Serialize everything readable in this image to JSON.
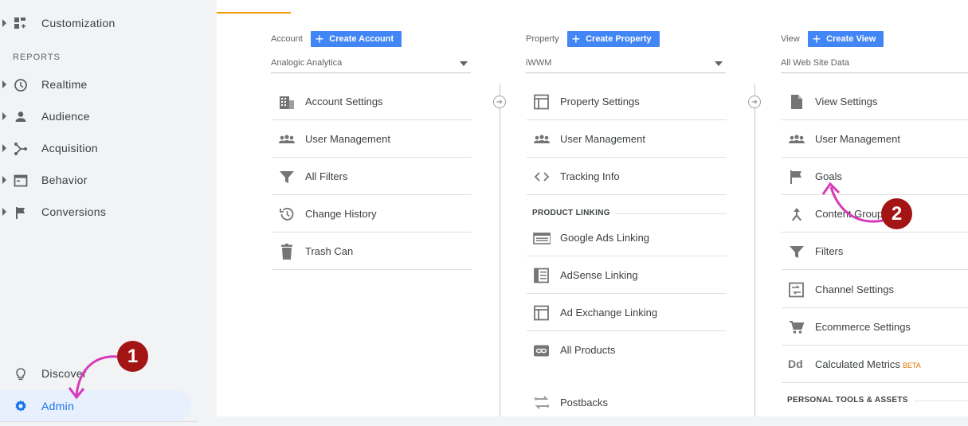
{
  "sidebar": {
    "customization": "Customization",
    "reports_heading": "REPORTS",
    "items": [
      {
        "label": "Realtime",
        "icon": "clock-icon"
      },
      {
        "label": "Audience",
        "icon": "person-icon"
      },
      {
        "label": "Acquisition",
        "icon": "acquisition-icon"
      },
      {
        "label": "Behavior",
        "icon": "behavior-icon"
      },
      {
        "label": "Conversions",
        "icon": "flag-icon"
      }
    ],
    "discover": "Discover",
    "admin": "Admin"
  },
  "account": {
    "label": "Account",
    "create_button": "Create Account",
    "selected": "Analogic Analytica",
    "rows": [
      "Account Settings",
      "User Management",
      "All Filters",
      "Change History",
      "Trash Can"
    ]
  },
  "property": {
    "label": "Property",
    "create_button": "Create Property",
    "selected": "iWWM",
    "rows": [
      "Property Settings",
      "User Management",
      "Tracking Info"
    ],
    "linking_heading": "PRODUCT LINKING",
    "linking_rows": [
      "Google Ads Linking",
      "AdSense Linking",
      "Ad Exchange Linking",
      "All Products",
      "Postbacks"
    ]
  },
  "view": {
    "label": "View",
    "create_button": "Create View",
    "selected": "All Web Site Data",
    "rows": [
      "View Settings",
      "User Management",
      "Goals",
      "Content Grouping",
      "Filters",
      "Channel Settings",
      "Ecommerce Settings",
      "Calculated Metrics"
    ],
    "beta": "BETA",
    "personal_heading": "PERSONAL TOOLS & ASSETS"
  },
  "annotations": {
    "step1": "1",
    "step2": "2"
  },
  "colors": {
    "accent": "#4285f4",
    "annotation": "#a31515",
    "arrow": "#d63ab8",
    "active_tab": "#f29900"
  }
}
